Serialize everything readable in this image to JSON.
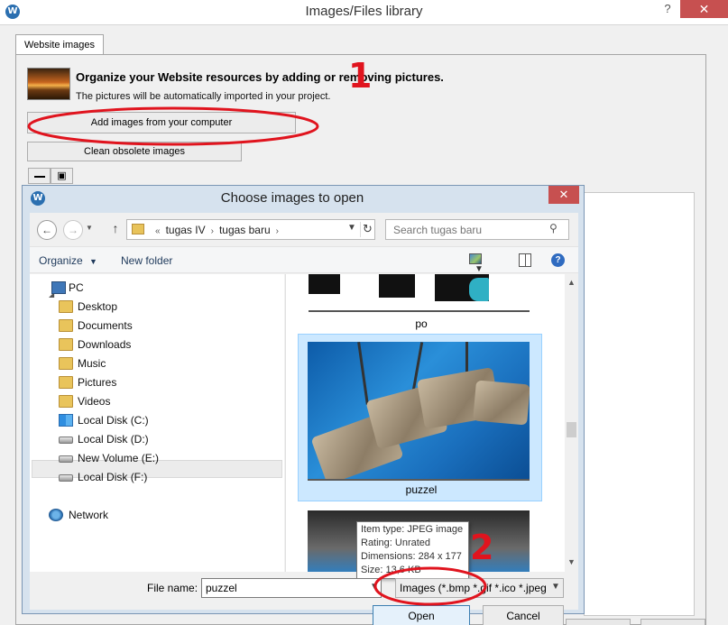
{
  "outer": {
    "title": "Images/Files library",
    "help_glyph": "?",
    "close_glyph": "✕",
    "tab": "Website images",
    "organize_title": "Organize your Website resources by adding or removing pictures.",
    "organize_sub": "The pictures will be automatically imported in your project.",
    "add_button": "Add images from your computer",
    "clean_button": "Clean obsolete images"
  },
  "annotations": {
    "one": "1",
    "two": "2",
    "color": "#e0141e"
  },
  "dialog": {
    "title": "Choose images to open",
    "close_glyph": "✕",
    "breadcrumb": [
      "tugas IV",
      "tugas baru"
    ],
    "search_placeholder": "Search tugas baru",
    "toolbar": {
      "organize": "Organize",
      "new_folder": "New folder"
    },
    "tree": [
      {
        "label": "PC",
        "icon": "pc-icon"
      },
      {
        "label": "Desktop",
        "icon": "folder-icon"
      },
      {
        "label": "Documents",
        "icon": "folder-icon"
      },
      {
        "label": "Downloads",
        "icon": "folder-icon"
      },
      {
        "label": "Music",
        "icon": "folder-icon"
      },
      {
        "label": "Pictures",
        "icon": "folder-icon"
      },
      {
        "label": "Videos",
        "icon": "folder-icon"
      },
      {
        "label": "Local Disk (C:)",
        "icon": "windows-drive-icon"
      },
      {
        "label": "Local Disk  (D:)",
        "icon": "drive-icon"
      },
      {
        "label": "New Volume (E:)",
        "icon": "drive-icon"
      },
      {
        "label": "Local Disk (F:)",
        "icon": "drive-icon"
      },
      {
        "label": "Network",
        "icon": "network-icon"
      }
    ],
    "files": [
      {
        "name": "po"
      },
      {
        "name": "puzzel",
        "selected": true
      }
    ],
    "tooltip": {
      "type": "Item type: JPEG image",
      "rating": "Rating: Unrated",
      "dimensions": "Dimensions: 284 x 177",
      "size": "Size: 13,6 KB"
    },
    "file_name_label": "File name:",
    "file_name_value": "puzzel",
    "file_type": "Images (*.bmp *.gif *.ico *.jpeg",
    "open_button": "Open",
    "cancel_button": "Cancel"
  }
}
